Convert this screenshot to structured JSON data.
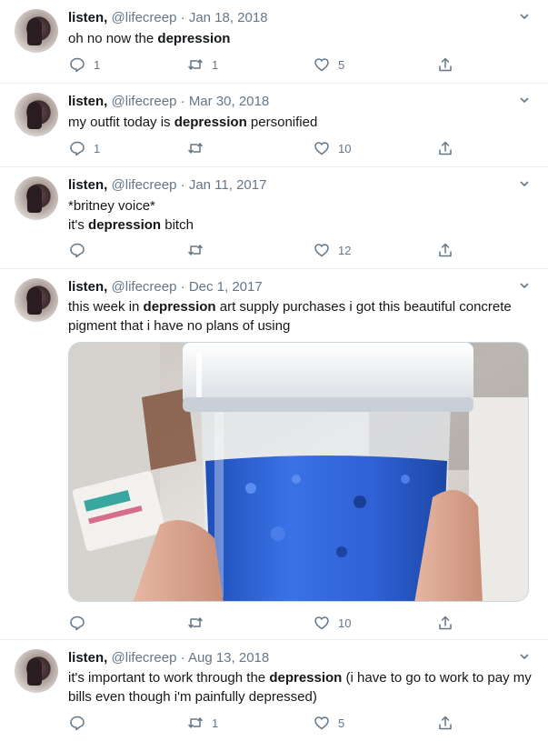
{
  "tweets": [
    {
      "name": "listen,",
      "handle": "@lifecreep",
      "sep": "·",
      "date": "Jan 18, 2018",
      "text_pre": "oh no now the ",
      "text_bold": "depression",
      "text_post": "",
      "replies": "1",
      "retweets": "1",
      "likes": "5"
    },
    {
      "name": "listen,",
      "handle": "@lifecreep",
      "sep": "·",
      "date": "Mar 30, 2018",
      "text_pre": "my outfit today is ",
      "text_bold": "depression",
      "text_post": " personified",
      "replies": "1",
      "retweets": "",
      "likes": "10"
    },
    {
      "name": "listen,",
      "handle": "@lifecreep",
      "sep": "·",
      "date": "Jan 11, 2017",
      "text_line1": "*britney voice*",
      "text_pre": "it's ",
      "text_bold": "depression",
      "text_post": " bitch",
      "replies": "",
      "retweets": "",
      "likes": "12"
    },
    {
      "name": "listen,",
      "handle": "@lifecreep",
      "sep": "·",
      "date": "Dec 1, 2017",
      "text_pre": "this week in ",
      "text_bold": "depression",
      "text_post": " art supply purchases i got this beautiful concrete pigment that i have no plans of using",
      "replies": "",
      "retweets": "",
      "likes": "10"
    },
    {
      "name": "listen,",
      "handle": "@lifecreep",
      "sep": "·",
      "date": "Aug 13, 2018",
      "text_pre": "it's important to work through the ",
      "text_bold": "depression",
      "text_post": " (i have to go to work to pay my bills even though i'm painfully depressed)",
      "replies": "",
      "retweets": "1",
      "likes": "5"
    }
  ],
  "colors": {
    "text": "#14171a",
    "muted": "#657786",
    "border": "#e6ecf0",
    "pigment_blue": "#2f63d8"
  },
  "icons": [
    "reply-icon",
    "retweet-icon",
    "like-icon",
    "share-icon",
    "chevron-down-icon"
  ]
}
